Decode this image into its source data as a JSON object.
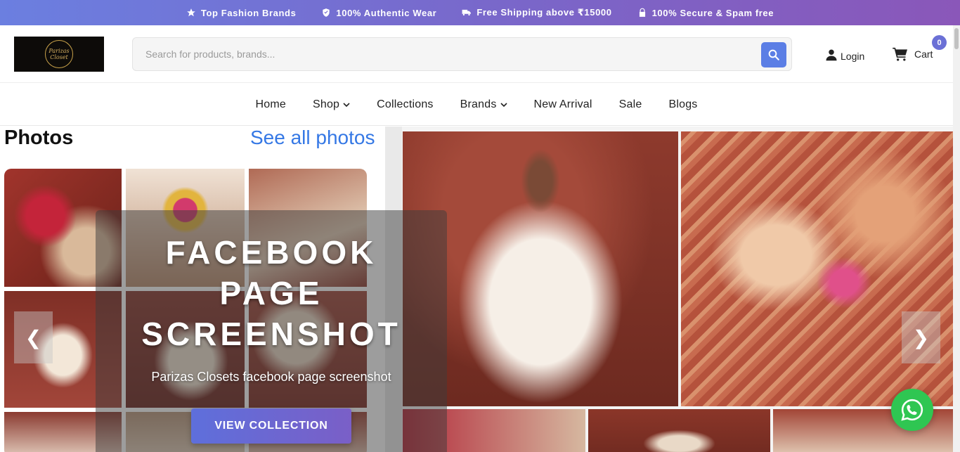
{
  "promo_bar": {
    "items": [
      {
        "icon": "star-icon",
        "label": "Top Fashion Brands"
      },
      {
        "icon": "shield-icon",
        "label": "100% Authentic Wear"
      },
      {
        "icon": "truck-icon",
        "label": "Free Shipping above ₹15000"
      },
      {
        "icon": "lock-icon",
        "label": "100% Secure & Spam free"
      }
    ]
  },
  "header": {
    "logo_text": "Parizas Closet",
    "search": {
      "placeholder": "Search for products, brands..."
    },
    "login_label": "Login",
    "cart_label": "Cart",
    "cart_count": "0"
  },
  "nav": {
    "items": [
      {
        "label": "Home",
        "dropdown": false
      },
      {
        "label": "Shop",
        "dropdown": true
      },
      {
        "label": "Collections",
        "dropdown": false
      },
      {
        "label": "Brands",
        "dropdown": true
      },
      {
        "label": "New Arrival",
        "dropdown": false
      },
      {
        "label": "Sale",
        "dropdown": false
      },
      {
        "label": "Blogs",
        "dropdown": false
      }
    ]
  },
  "hero": {
    "fb_title": "Photos",
    "fb_link": "See all photos",
    "title_line1": "FACEBOOK",
    "title_line2": "PAGE",
    "title_line3": "SCREENSHOT",
    "subtitle": "Parizas Closets facebook page screenshot",
    "cta_label": "VIEW COLLECTION",
    "prev_arrow": "❮",
    "next_arrow": "❯"
  },
  "colors": {
    "accent": "#5b7ee5",
    "whatsapp": "#2fc652",
    "promo_gradient_start": "#6b7fe0",
    "promo_gradient_end": "#8a57b9"
  }
}
